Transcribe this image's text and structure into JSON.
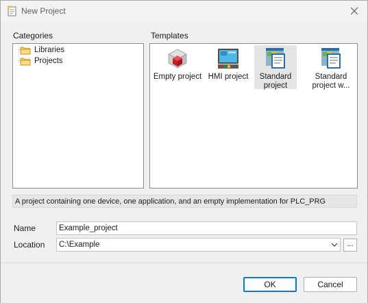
{
  "window": {
    "title": "New Project"
  },
  "categories": {
    "label": "Categories",
    "items": [
      {
        "label": "Libraries"
      },
      {
        "label": "Projects"
      }
    ]
  },
  "templates": {
    "label": "Templates",
    "items": [
      {
        "label": "Empty project",
        "icon": "empty-project-icon"
      },
      {
        "label": "HMI project",
        "icon": "hmi-project-icon"
      },
      {
        "label": "Standard project",
        "label_line1": "Standard",
        "label_line2": "project",
        "icon": "standard-project-icon"
      },
      {
        "label": "Standard project w...",
        "label_line1": "Standard",
        "label_line2": "project w...",
        "icon": "standard-project-with-icon"
      }
    ]
  },
  "description": "A project containing one device, one application, and an empty implementation for PLC_PRG",
  "form": {
    "name_label": "Name",
    "name_value": "Example_project",
    "location_label": "Location",
    "location_value": "C:\\Example",
    "browse_label": "..."
  },
  "buttons": {
    "ok": "OK",
    "cancel": "Cancel"
  },
  "colors": {
    "accent": "#0078d7",
    "folder": "#e8b84a",
    "cube": "#d9262c"
  }
}
